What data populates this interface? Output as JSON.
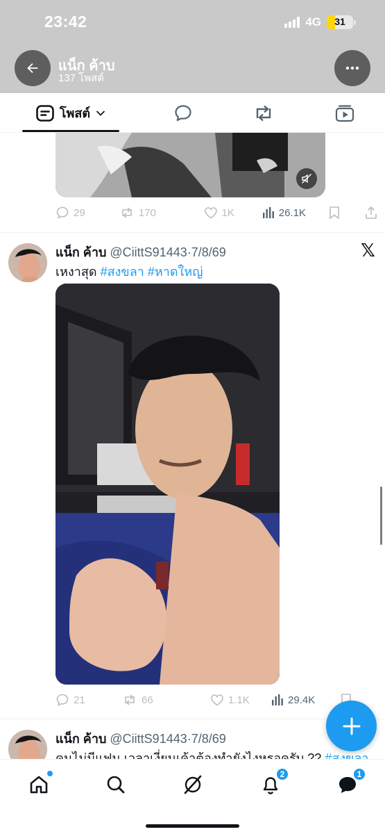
{
  "status_bar": {
    "time": "23:42",
    "network": "4G",
    "battery": "31",
    "battery_level": 0.31
  },
  "header": {
    "title": "แน็ก ค้าบ",
    "subtitle": "137 โพสต์"
  },
  "tabs": {
    "posts_label": "โพสต์"
  },
  "prev_tweet": {
    "actions": {
      "replies": "29",
      "reposts": "170",
      "likes": "1K",
      "views": "26.1K"
    }
  },
  "tweet1": {
    "name": "แน็ก ค้าบ",
    "handle": "@CiittS91443",
    "date": "·7/8/69",
    "text": "เหงาสุด",
    "hashtags": [
      "#สงขลา",
      "#หาดใหญ่"
    ],
    "actions": {
      "replies": "21",
      "reposts": "66",
      "likes": "1.1K",
      "views": "29.4K"
    }
  },
  "tweet2": {
    "name": "แน็ก ค้าบ",
    "handle": "@CiittS91443",
    "date": "·7/8/69",
    "text": "คนไม่มีแฟน เวลาเงี่ยนเค้าต้องทำยังไงหรอครับ ??",
    "hashtag": "#สงขลา"
  },
  "bottom_nav": {
    "notifications_badge": "2",
    "messages_badge": "1"
  },
  "icons": {
    "back": "arrow-left-icon",
    "more": "ellipsis-icon",
    "posts_tab": "post-icon",
    "replies_tab": "speech-bubble-icon",
    "reposts_tab": "repost-icon",
    "media_tab": "video-icon",
    "mute": "muted-speaker-icon",
    "platform": "x-logo-icon",
    "compose": "plus-icon",
    "home": "home-icon",
    "search": "search-icon",
    "grok": "grok-icon",
    "notifications": "bell-icon",
    "messages": "mail-icon"
  },
  "colors": {
    "accent": "#1d9bf0",
    "header_bg": "#c9c9c9",
    "text": "#0f1419",
    "muted": "#536471"
  }
}
